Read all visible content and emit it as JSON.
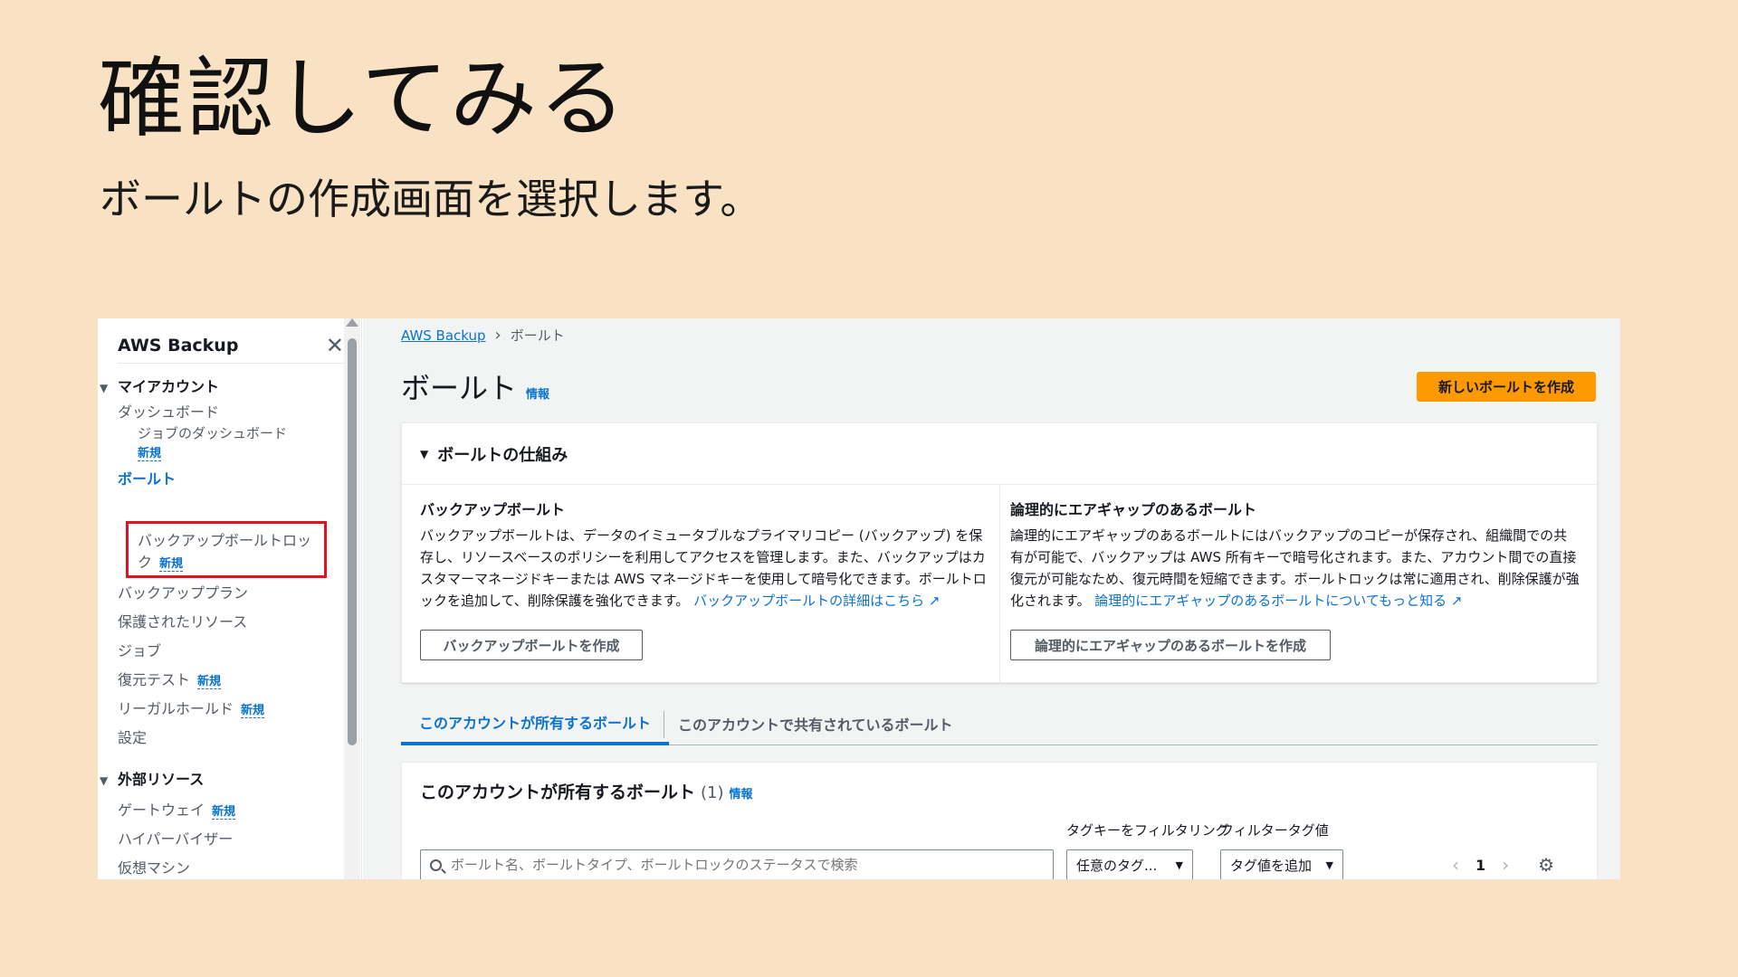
{
  "slide": {
    "title": "確認してみる",
    "subtitle": "ボールトの作成画面を選択します。"
  },
  "sidebar": {
    "title": "AWS Backup",
    "close_icon": "✕",
    "section_my_account": "マイアカウント",
    "dashboard": "ダッシュボード",
    "jobs_dashboard": "ジョブのダッシュボード",
    "new_label": "新規",
    "vaults": "ボールト",
    "vault_lock_line1": "バックアップボールトロッ",
    "vault_lock_line2": "ク",
    "backup_plans": "バックアッププラン",
    "protected_resources": "保護されたリソース",
    "jobs": "ジョブ",
    "restore_testing": "復元テスト",
    "legal_holds": "リーガルホールド",
    "settings": "設定",
    "section_external": "外部リソース",
    "gateways": "ゲートウェイ",
    "hypervisors": "ハイパーバイザー",
    "virtual_machines": "仮想マシン"
  },
  "breadcrumb": {
    "root": "AWS Backup",
    "current": "ボールト"
  },
  "page": {
    "title": "ボールト",
    "info": "情報",
    "create_vault_button": "新しいボールトを作成"
  },
  "how_it_works": {
    "title": "ボールトの仕組み",
    "backup_vault": {
      "title": "バックアップボールト",
      "body": "バックアップボールトは、データのイミュータブルなプライマリコピー (バックアップ) を保存し、リソースベースのポリシーを利用してアクセスを管理します。また、バックアップはカスタマーマネージドキーまたは AWS マネージドキーを使用して暗号化できます。ボールトロックを追加して、削除保護を強化できます。",
      "link": "バックアップボールトの詳細はこちら",
      "button": "バックアップボールトを作成"
    },
    "air_gapped_vault": {
      "title": "論理的にエアギャップのあるボールト",
      "body": "論理的にエアギャップのあるボールトにはバックアップのコピーが保存され、組織間での共有が可能で、バックアップは AWS 所有キーで暗号化されます。また、アカウント間での直接復元が可能なため、復元時間を短縮できます。ボールトロックは常に適用され、削除保護が強化されます。",
      "link": "論理的にエアギャップのあるボールトについてもっと知る",
      "button": "論理的にエアギャップのあるボールトを作成"
    }
  },
  "tabs": [
    {
      "label": "このアカウントが所有するボールト"
    },
    {
      "label": "このアカウントで共有されているボールト"
    }
  ],
  "owned_vaults": {
    "title": "このアカウントが所有するボールト",
    "count": "(1)",
    "info": "情報",
    "search_placeholder": "ボールト名、ボールトタイプ、ボールトロックのステータスで検索",
    "tag_key_label": "タグキーをフィルタリング",
    "tag_key_value": "任意のタグ...",
    "tag_value_label": "フィルタータグ値",
    "tag_value_value": "タグ値を追加",
    "page_number": "1"
  },
  "colors": {
    "background": "#f9e2c4",
    "accent_link": "#0972d3",
    "primary_button": "#ff9900",
    "highlight_box": "#e0141e"
  }
}
